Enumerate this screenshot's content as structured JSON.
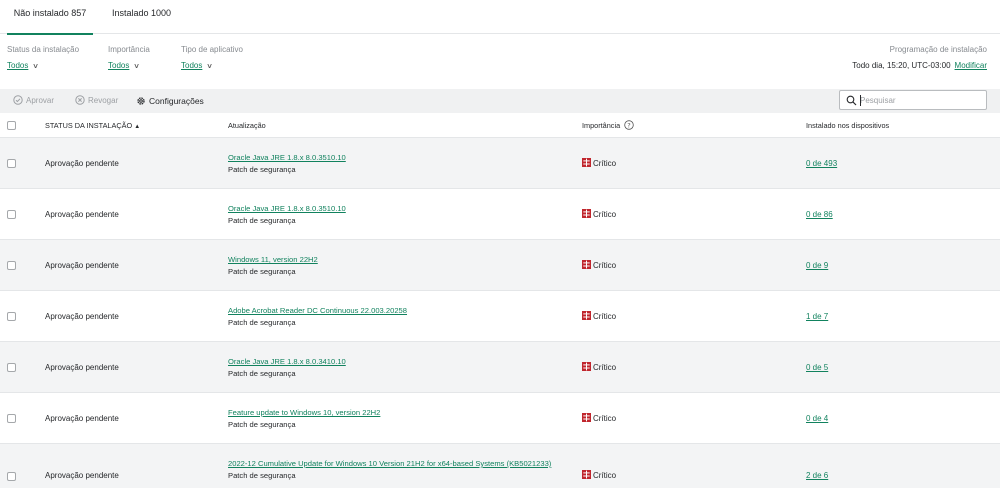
{
  "tabs": [
    {
      "label": "Não instalado 857",
      "active": true
    },
    {
      "label": "Instalado 1000",
      "active": false
    }
  ],
  "filters": {
    "install_status": {
      "label": "Status da instalação",
      "value": "Todos"
    },
    "importance": {
      "label": "Importância",
      "value": "Todos"
    },
    "app_type": {
      "label": "Tipo de aplicativo",
      "value": "Todos"
    }
  },
  "schedule": {
    "label": "Programação de instalação",
    "value": "Todo dia, 15:20, UTC-03:00",
    "modify_label": "Modificar"
  },
  "toolbar": {
    "approve_label": "Aprovar",
    "revoke_label": "Revogar",
    "settings_label": "Configurações",
    "search_placeholder": "Pesquisar"
  },
  "table": {
    "columns": {
      "status": "Status da instalação",
      "update": "Atualização",
      "importance": "Importância",
      "installed": "Instalado nos dispositivos"
    },
    "rows": [
      {
        "status": "Aprovação pendente",
        "update": "Oracle Java JRE 1.8.x 8.0.3510.10",
        "type": "Patch de segurança",
        "importance": "Crítico",
        "installed": "0 de 493"
      },
      {
        "status": "Aprovação pendente",
        "update": "Oracle Java JRE 1.8.x 8.0.3510.10",
        "type": "Patch de segurança",
        "importance": "Crítico",
        "installed": "0 de 86"
      },
      {
        "status": "Aprovação pendente",
        "update": "Windows 11, version 22H2",
        "type": "Patch de segurança",
        "importance": "Crítico",
        "installed": "0 de 9"
      },
      {
        "status": "Aprovação pendente",
        "update": "Adobe Acrobat Reader DC Continuous 22.003.20258",
        "type": "Patch de segurança",
        "importance": "Crítico",
        "installed": "1 de 7"
      },
      {
        "status": "Aprovação pendente",
        "update": "Oracle Java JRE 1.8.x 8.0.3410.10",
        "type": "Patch de segurança",
        "importance": "Crítico",
        "installed": "0 de 5"
      },
      {
        "status": "Aprovação pendente",
        "update": "Feature update to Windows 10, version 22H2",
        "type": "Patch de segurança",
        "importance": "Crítico",
        "installed": "0 de 4"
      },
      {
        "status": "Aprovação pendente",
        "update": "2022-12 Cumulative Update for Windows 10 Version 21H2 for x64-based Systems (KB5021233)",
        "type": "Patch de segurança",
        "importance": "Crítico",
        "installed": "2 de 6"
      }
    ]
  },
  "colors": {
    "accent": "#11825e",
    "critical": "#c0262d",
    "toolbar_bg": "#f0f1f2",
    "row_alt_bg": "#f3f4f5"
  },
  "icons": {
    "approve": "check-circle-icon",
    "revoke": "x-circle-icon",
    "settings": "gear-icon",
    "search": "search-icon",
    "help": "question-circle-icon",
    "critical": "critical-severity-icon",
    "sort": "sort-asc-icon",
    "dropdown": "chevron-down-icon"
  }
}
